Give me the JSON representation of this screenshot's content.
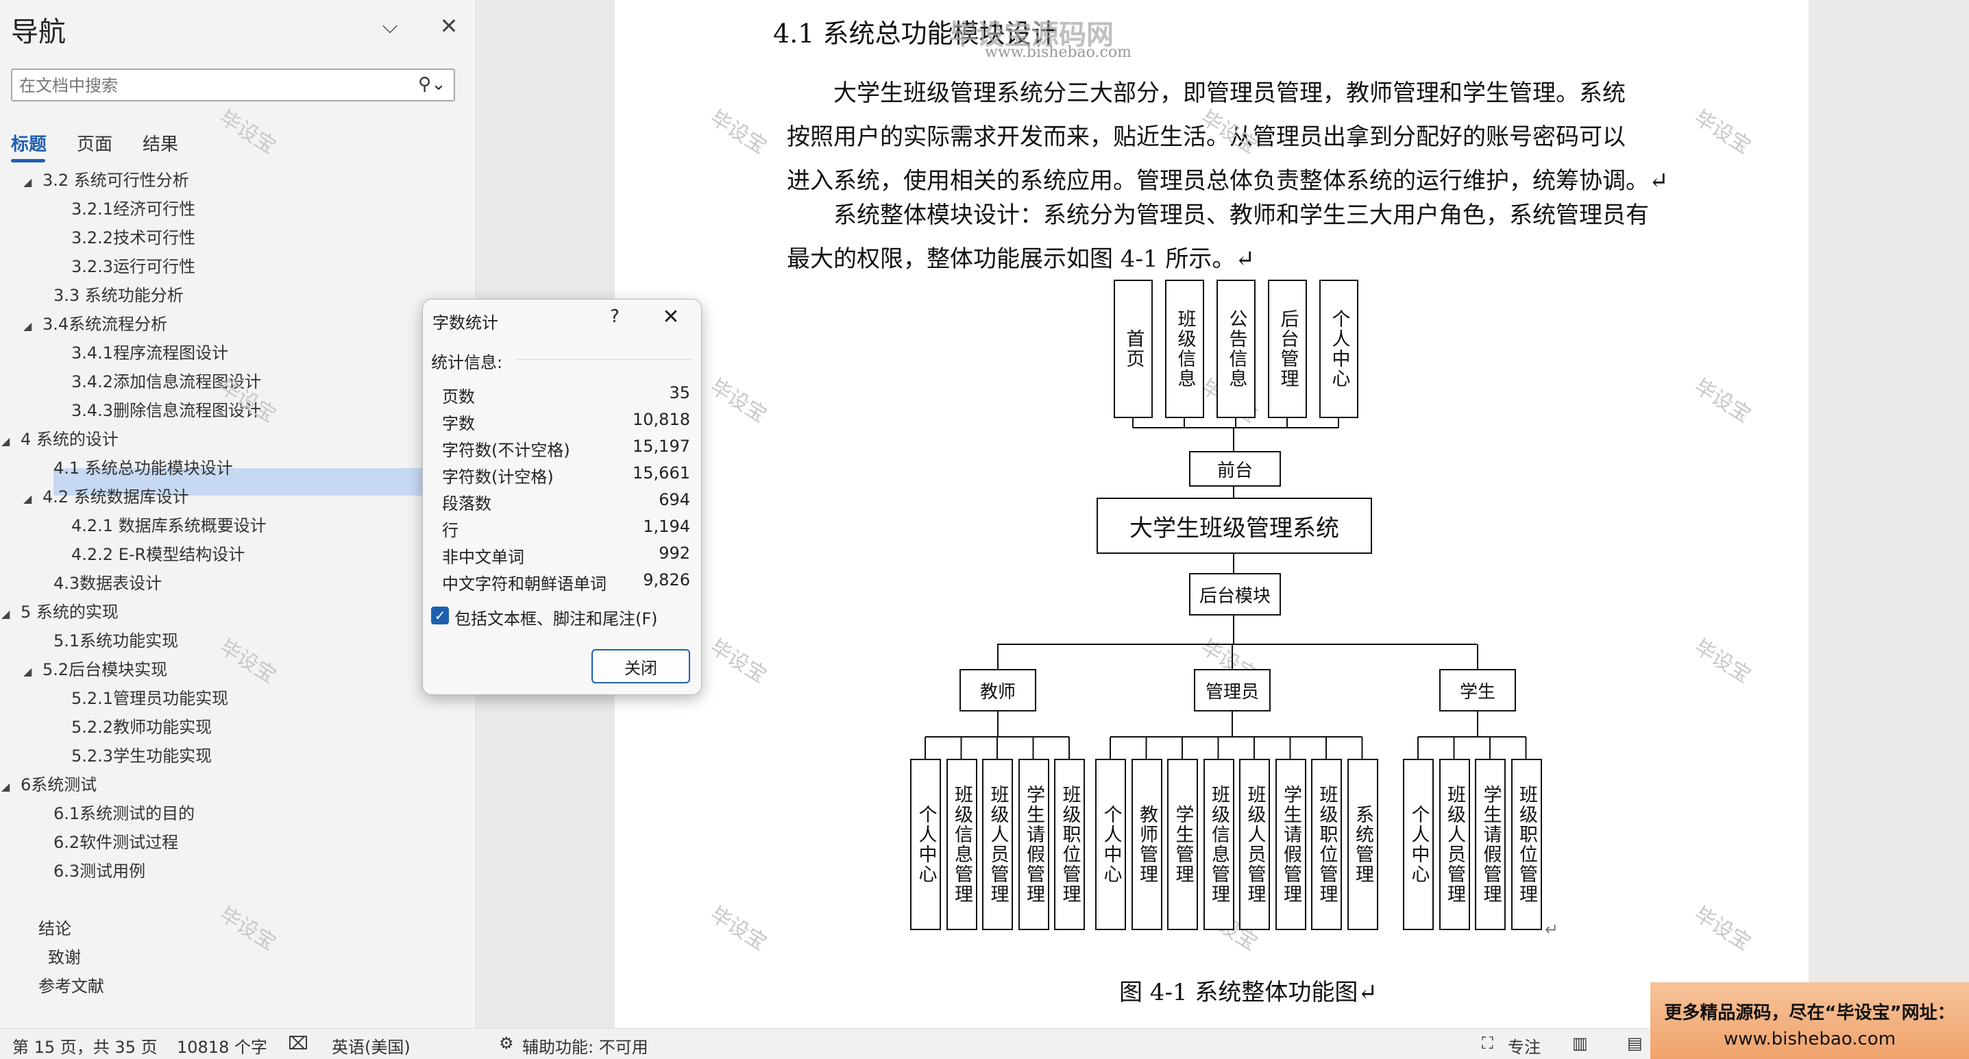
{
  "nav": {
    "title": "导航",
    "search_placeholder": "在文档中搜索",
    "tabs": [
      "标题",
      "页面",
      "结果"
    ],
    "toc": [
      {
        "label": "3.2 系统可行性分析",
        "collapse": "◢"
      },
      {
        "label": "3.2.1经济可行性"
      },
      {
        "label": "3.2.2技术可行性"
      },
      {
        "label": "3.2.3运行可行性"
      },
      {
        "label": "3.3 系统功能分析"
      },
      {
        "label": "3.4系统流程分析",
        "collapse": "◢"
      },
      {
        "label": "3.4.1程序流程图设计"
      },
      {
        "label": "3.4.2添加信息流程图设计"
      },
      {
        "label": "3.4.3删除信息流程图设计"
      },
      {
        "label": "4  系统的设计",
        "collapse": "◢"
      },
      {
        "label": "4.1 系统总功能模块设计"
      },
      {
        "label": "4.2 系统数据库设计",
        "collapse": "◢"
      },
      {
        "label": "4.2.1 数据库系统概要设计"
      },
      {
        "label": "4.2.2 E-R模型结构设计"
      },
      {
        "label": "4.3数据表设计"
      },
      {
        "label": "5  系统的实现",
        "collapse": "◢"
      },
      {
        "label": "5.1系统功能实现"
      },
      {
        "label": "5.2后台模块实现",
        "collapse": "◢"
      },
      {
        "label": "5.2.1管理员功能实现"
      },
      {
        "label": "5.2.2教师功能实现"
      },
      {
        "label": "5.2.3学生功能实现"
      },
      {
        "label": "6系统测试",
        "collapse": "◢"
      },
      {
        "label": "6.1系统测试的目的"
      },
      {
        "label": "6.2软件测试过程"
      },
      {
        "label": "6.3测试用例"
      },
      {
        "label": "结论"
      },
      {
        "label": "致谢"
      },
      {
        "label": "参考文献"
      }
    ]
  },
  "document": {
    "heading": "4.1  系统总功能模块设计",
    "logo_text": "毕设宝源码网",
    "logo_url": "www.bishebao.com",
    "para1_lines": [
      "大学生班级管理系统分三大部分，即管理员管理，教师管理和学生管理。系统",
      "按照用户的实际需求开发而来，贴近生活。从管理员出拿到分配好的账号密码可以",
      "进入系统，使用相关的系统应用。管理员总体负责整体系统的运行维护，统筹协调。↵"
    ],
    "para2_lines": [
      "系统整体模块设计：系统分为管理员、教师和学生三大用户角色，系统管理员有",
      "最大的权限，整体功能展示如图 4-1 所示。↵"
    ],
    "watermark": "毕设宝",
    "diagram": {
      "top_boxes": [
        "首页",
        "班级信息",
        "公告信息",
        "后台管理",
        "个人中心"
      ],
      "front": "前台",
      "system": "大学生班级管理系统",
      "backend": "后台模块",
      "roles": [
        "教师",
        "管理员",
        "学生"
      ],
      "teacher_items": [
        "个人中心",
        "班级信息管理",
        "班级人员管理",
        "学生请假管理",
        "班级职位管理"
      ],
      "admin_items": [
        "个人中心",
        "教师管理",
        "学生管理",
        "班级信息管理",
        "班级人员管理",
        "学生请假管理",
        "班级职位管理",
        "系统管理"
      ],
      "student_items": [
        "个人中心",
        "班级人员管理",
        "学生请假管理",
        "班级职位管理"
      ],
      "return_mark": "↵"
    },
    "caption": "图 4-1  系统整体功能图↵"
  },
  "dialog": {
    "title": "字数统计",
    "help": "?",
    "section": "统计信息:",
    "stats": [
      {
        "label": "页数",
        "value": "35"
      },
      {
        "label": "字数",
        "value": "10,818"
      },
      {
        "label": "字符数(不计空格)",
        "value": "15,197"
      },
      {
        "label": "字符数(计空格)",
        "value": "15,661"
      },
      {
        "label": "段落数",
        "value": "694"
      },
      {
        "label": "行",
        "value": "1,194"
      },
      {
        "label": "非中文单词",
        "value": "992"
      },
      {
        "label": "中文字符和朝鲜语单词",
        "value": "9,826"
      }
    ],
    "checkbox_label": "包括文本框、脚注和尾注(F)",
    "checkbox_checked": true,
    "close_label": "关闭"
  },
  "status": {
    "page": "第 15 页，共 35 页",
    "words": "10818 个字",
    "language": "英语(美国)",
    "accessibility": "辅助功能: 不可用",
    "focus": "专注"
  },
  "promo": {
    "line1": "更多精品源码，尽在“毕设宝”网址：",
    "line2": "www.bishebao.com"
  }
}
